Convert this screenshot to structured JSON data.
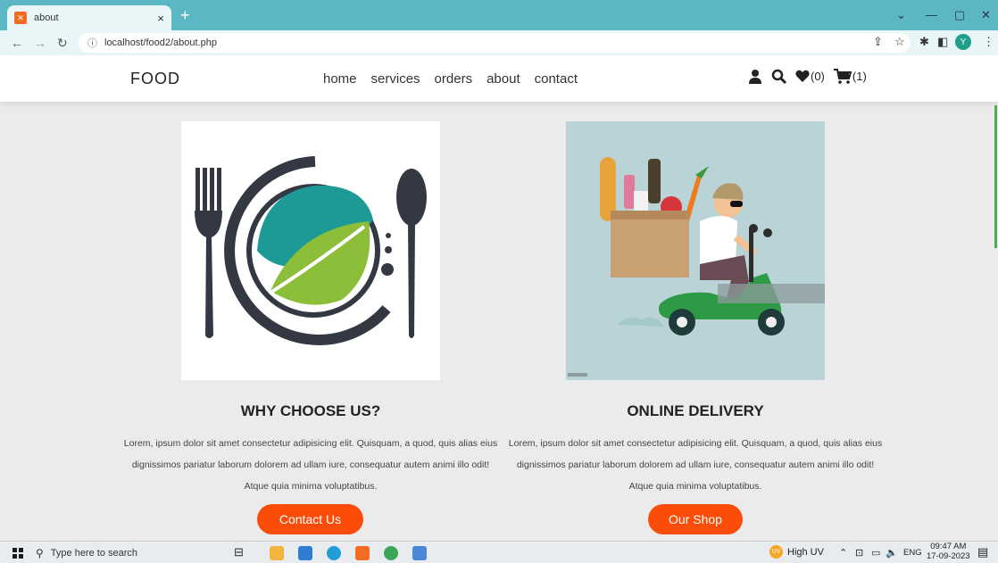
{
  "browser": {
    "tab_title": "about",
    "url": "localhost/food2/about.php"
  },
  "header": {
    "logo": "FOOD",
    "nav": [
      "home",
      "services",
      "orders",
      "about",
      "contact"
    ],
    "wishlist_count": "(0)",
    "cart_count": "(1)"
  },
  "sections": [
    {
      "title": "WHY CHOOSE US?",
      "text": "Lorem, ipsum dolor sit amet consectetur adipisicing elit. Quisquam, a quod, quis alias eius dignissimos pariatur laborum dolorem ad ullam iure, consequatur autem animi illo odit! Atque quia minima voluptatibus.",
      "button": "Contact Us"
    },
    {
      "title": "ONLINE DELIVERY",
      "text": "Lorem, ipsum dolor sit amet consectetur adipisicing elit. Quisquam, a quod, quis alias eius dignissimos pariatur laborum dolorem ad ullam iure, consequatur autem animi illo odit! Atque quia minima voluptatibus.",
      "button": "Our Shop"
    }
  ],
  "taskbar": {
    "search_placeholder": "Type here to search",
    "weather": "High UV",
    "language": "ENG",
    "time": "09:47 AM",
    "date": "17-09-2023",
    "uv_badge": "UV",
    "profile_initial": "Y"
  },
  "colors": {
    "accent": "#fb4c0a",
    "tabbar": "#5bb7c4"
  }
}
